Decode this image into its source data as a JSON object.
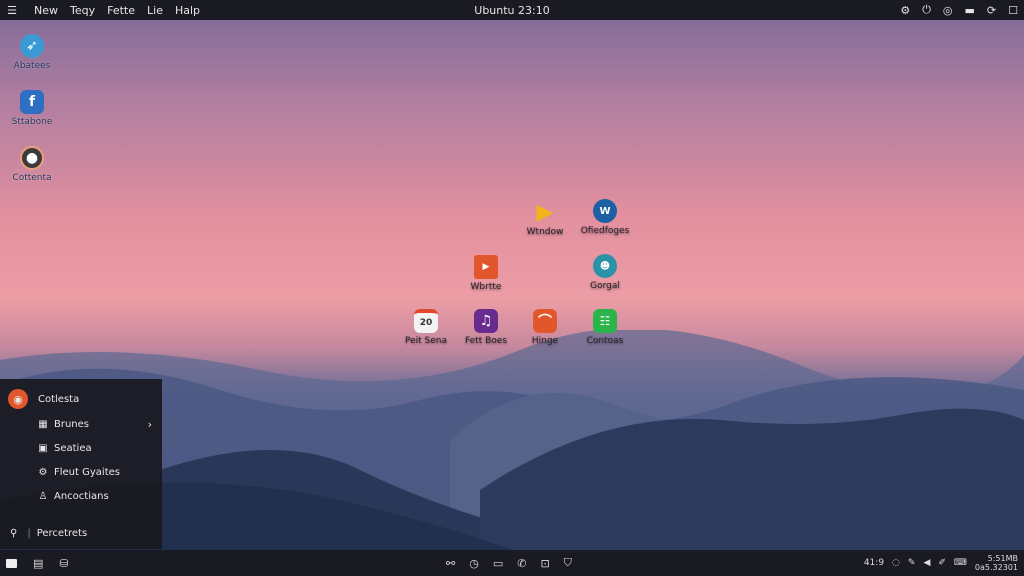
{
  "topbar": {
    "menu": [
      "New",
      "Teqy",
      "Fette",
      "Lie",
      "Halp"
    ],
    "clock": "Ubuntu 23:10",
    "tray_icons": [
      "settings-icon",
      "power-icon",
      "globe-icon",
      "minimize-icon",
      "rotate-icon",
      "close-icon"
    ]
  },
  "desktop": {
    "left_icons": [
      {
        "label": "Abatees",
        "icon": "bird-icon",
        "color": "#3a9ad6"
      },
      {
        "label": "Sttabone",
        "icon": "facebook-icon",
        "color": "#2e6fc4"
      },
      {
        "label": "Cottenta",
        "icon": "disc-icon",
        "color": "#3b3b3b"
      }
    ],
    "center_icons": [
      {
        "label": "Wtndow",
        "icon": "play-icon",
        "color": "#f2b418"
      },
      {
        "label": "Ofiedfoges",
        "icon": "wp-icon",
        "color": "#1f5fa3"
      },
      {
        "label": "Wbrtte",
        "icon": "folder-icon",
        "color": "#e2562b"
      },
      {
        "label": "Gorgal",
        "icon": "chat-icon",
        "color": "#2b93a8"
      },
      {
        "label": "Peit Sena",
        "icon": "calendar-icon",
        "color": "#f3f3f3"
      },
      {
        "label": "Fett Boes",
        "icon": "music-icon",
        "color": "#6a2b8e"
      },
      {
        "label": "Hinge",
        "icon": "ubuntu-icon",
        "color": "#e2562b"
      },
      {
        "label": "Contoas",
        "icon": "spreadsheet-icon",
        "color": "#2bb44a"
      }
    ]
  },
  "startmenu": {
    "header": "Cotlesta",
    "items": [
      {
        "label": "Brunes",
        "icon": "grid-icon",
        "chevron": "›"
      },
      {
        "label": "Seatiea",
        "icon": "window-icon"
      },
      {
        "label": "Fleut Gyaites",
        "icon": "gear-icon"
      },
      {
        "label": "Ancoctians",
        "icon": "user-icon"
      }
    ],
    "footer": "Percetrets",
    "footer_icon": "pin-icon"
  },
  "taskbar": {
    "left_icons": [
      "terminal-icon",
      "files-icon",
      "store-icon"
    ],
    "center_icons": [
      "link-icon",
      "clock-icon",
      "folder-icon",
      "phone-icon",
      "edit-icon",
      "shield-icon"
    ],
    "right_time": "41:9",
    "right_clock_1": "5:51MB",
    "right_clock_2": "0a5.32301"
  },
  "colors": {
    "menu_bg": "#1a1a22",
    "accent": "#e2562b"
  }
}
